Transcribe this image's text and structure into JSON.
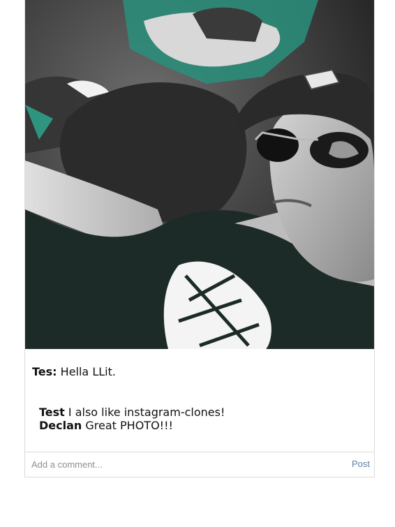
{
  "post": {
    "caption": {
      "username": "Tes:",
      "text": "Hella LLit."
    },
    "comments": [
      {
        "username": "Test",
        "text": "I also like instagram-clones!"
      },
      {
        "username": "Declan",
        "text": "Great PHOTO!!!"
      }
    ],
    "comment_form": {
      "placeholder": "Add a comment...",
      "post_label": "Post"
    }
  },
  "photo": {
    "description_icon": "photo-image",
    "colors": {
      "background": "#3a3f3c",
      "teal": "#2bbfa0",
      "shirt": "#1c2b27"
    }
  }
}
